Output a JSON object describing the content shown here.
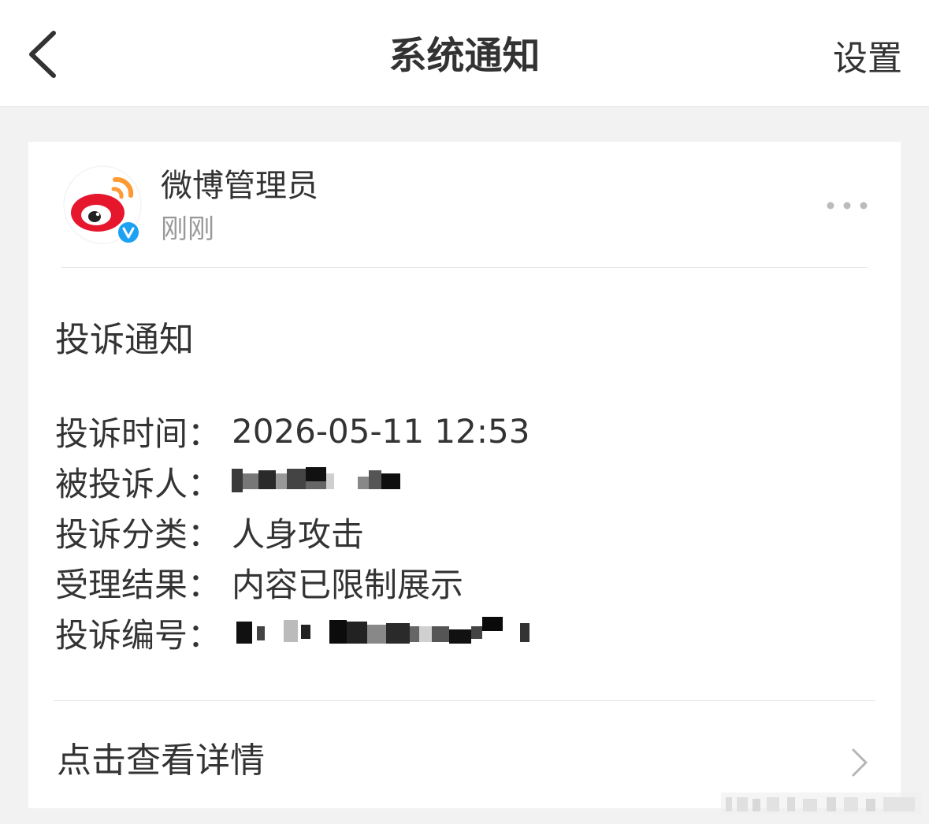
{
  "header": {
    "title": "系统通知",
    "settings_label": "设置",
    "back_icon": "chevron-left-icon"
  },
  "card": {
    "sender": {
      "name": "微博管理员",
      "time": "刚刚",
      "avatar_icon": "weibo-logo-icon",
      "verified_badge": "verified-v-icon",
      "more_icon": "more-dots-icon"
    },
    "notice_title": "投诉通知",
    "fields": [
      {
        "label": "投诉时间：",
        "value": "2026-05-11 12:53"
      },
      {
        "label": "被投诉人：",
        "value": "",
        "redacted": true
      },
      {
        "label": "投诉分类：",
        "value": "人身攻击"
      },
      {
        "label": "受理结果：",
        "value": "内容已限制展示"
      },
      {
        "label": "投诉编号：",
        "value": "",
        "redacted": true
      }
    ],
    "detail_link": "点击查看详情",
    "detail_chevron_icon": "chevron-right-icon"
  },
  "colors": {
    "background": "#f2f2f2",
    "card": "#ffffff",
    "text": "#333333",
    "muted": "#999999",
    "weibo_red": "#e6162d",
    "weibo_orange": "#ff9933",
    "verified_blue": "#1da1f2"
  }
}
